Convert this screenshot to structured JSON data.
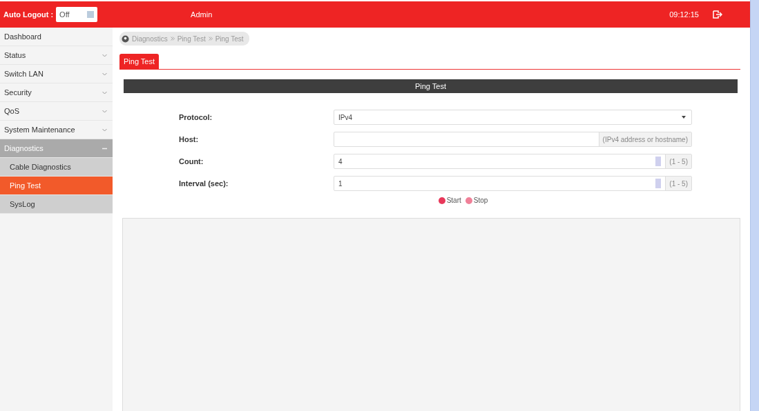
{
  "top_bar": {
    "auto_logout_label": "Auto Logout :",
    "auto_logout_value": "Off",
    "user": "Admin",
    "time": "09:12:15"
  },
  "sidebar": {
    "items": [
      {
        "label": "Dashboard",
        "expandable": false,
        "expanded": false,
        "selected": false
      },
      {
        "label": "Status",
        "expandable": true,
        "expanded": false,
        "selected": false
      },
      {
        "label": "Switch LAN",
        "expandable": true,
        "expanded": false,
        "selected": false
      },
      {
        "label": "Security",
        "expandable": true,
        "expanded": false,
        "selected": false
      },
      {
        "label": "QoS",
        "expandable": true,
        "expanded": false,
        "selected": false
      },
      {
        "label": "System Maintenance",
        "expandable": true,
        "expanded": false,
        "selected": false
      },
      {
        "label": "Diagnostics",
        "expandable": true,
        "expanded": true,
        "selected": false,
        "children": [
          {
            "label": "Cable Diagnostics",
            "selected": false
          },
          {
            "label": "Ping Test",
            "selected": true
          },
          {
            "label": "SysLog",
            "selected": false
          }
        ]
      }
    ]
  },
  "breadcrumb": [
    "Diagnostics",
    "Ping Test",
    "Ping Test"
  ],
  "tabs": [
    {
      "label": "Ping Test",
      "selected": true
    }
  ],
  "panel": {
    "title": "Ping Test",
    "fields": [
      {
        "kind": "select",
        "label": "Protocol:",
        "value": "IPv4"
      },
      {
        "kind": "text",
        "label": "Host:",
        "hint": "(IPv4 address or hostname)"
      },
      {
        "kind": "spin",
        "label": "Count:",
        "value": "4",
        "hint": "(1 - 5)"
      },
      {
        "kind": "spin",
        "label": "Interval (sec):",
        "value": "1",
        "hint": "(1 - 5)"
      }
    ],
    "buttons": [
      {
        "label": "Start",
        "kind": "start"
      },
      {
        "label": "Stop",
        "kind": "stop"
      }
    ]
  }
}
